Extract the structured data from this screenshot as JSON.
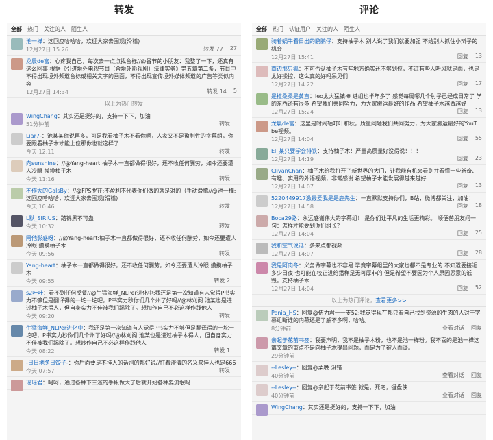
{
  "headers": {
    "left": "转发",
    "right": "评论"
  },
  "left": {
    "tabs": [
      "全部",
      "热门",
      "关注的人",
      "陌生人"
    ],
    "items": [
      {
        "user": "池一樺",
        "text": "：这回应哈哈哈，欢迎大家去围观(滑稽)",
        "time": "12月27日 15:26",
        "actions": [
          "转发 77",
          "27"
        ],
        "color": "#9bb"
      },
      {
        "user": "龙晨de富",
        "text": "：心疼我自己，每次去一点点找台标//@番节的小朋友：我整了一下，还真有这么回事 根据《引进境外电视节目（含境外影视剧）法律实务》第五章第二条，节目中不得出现境外频道台标或相关文字的画面，不得出现宣传境外媒体频道的广告等类似内容",
        "time": "12月27日 14:34",
        "actions": [
          "转发 14",
          "5"
        ],
        "color": "#c98"
      }
    ],
    "sep": "以上为热门转发",
    "items2": [
      {
        "user": "WingChang",
        "text": "：其实还是挺好的，支持一下下，加油",
        "time": "51分钟前",
        "actions": [
          "转发",
          ""
        ],
        "color": "#a9c"
      },
      {
        "user": "Liar7-",
        "text": "：池某某你说再多，可是我看柚子木不看你啊，人家又不是盈利性的字幕组，你要跟看柚子木才能上位那你也就这样了",
        "time": "今天 12:11",
        "actions": [
          "转发",
          ""
        ],
        "color": "#ccc"
      },
      {
        "user": "向sunshine",
        "text": "：//@Yang-heart:柚子木一直都做得很好，还不收任何酬劳，如今还要遭人冷眼 摸摸柚子木",
        "time": "今天 11:16",
        "actions": [
          "转发",
          ""
        ],
        "color": "#dcb"
      },
      {
        "user": "不作大的GalsBy",
        "text": "：//@FPS罗茌:不盈利不代表你们做的就是对的（手动滑稽//@池一樺:这回应哈哈哈，欢迎大家去围观(滑稽)",
        "time": "今天 10:46",
        "actions": [
          "转发",
          ""
        ],
        "color": "#bca"
      },
      {
        "user": "L默_SIRIUS",
        "text": "：踏锦黑不可蛊",
        "time": "今天 10:32",
        "actions": [
          "转发",
          ""
        ],
        "color": "#556"
      },
      {
        "user": "阿他影感呀",
        "text": "：//@Yang-heart:柚子木一直都做得很好，还不收任何酬劳，如今还要遭人冷眼 摸摸柚子木",
        "time": "今天 09:56",
        "actions": [
          "转发",
          ""
        ],
        "color": "#b97"
      },
      {
        "user": "Yang-heart",
        "text": "：柚子木一直都做得很好，还不收任何酬劳，如今还要遭人冷眼 摸摸柚子木",
        "time": "今天 09:55",
        "actions": [
          "转发 2",
          ""
        ],
        "color": "#ccc"
      },
      {
        "user": "s2叶叶",
        "text": "：看不到任何反餐//@生猛海鲜_NLPer进化中:我还是第一次知道有人觉得P书实力不够但是翻译得的一坨一坨吧，P书实力秒你们几个州了好吗//@林刈阁:池某也是进过柚子木得人，但自身实力不佳被我们踢除了。想加作自己不必这样作践他人",
        "time": "今天 09:20",
        "actions": [
          "转发",
          ""
        ],
        "color": "#9ac"
      },
      {
        "user": "生猛海鲜_NLPer进化中",
        "text": "：我还是第一次知道有人觉得P书实力不够但是翻译得的一坨一坨吧，P书实力秒你们几个州了好吗//@林刈阁:池某也是进过柚子木得人，但自身实力不佳被我们踢除了。想炒作自己不必这样作践他人",
        "time": "今天 08:22",
        "actions": [
          "转发 1",
          ""
        ],
        "color": "#68a"
      },
      {
        "user": "-日日地冬日饺子-",
        "text": "：你后面要是不挂人的话别的都好说//打着澄清的名义来挂人也是666",
        "time": "今天 07:57",
        "actions": [
          "转发",
          ""
        ],
        "color": "#ca8"
      },
      {
        "user": "瑶瑶君",
        "text": "：呵呵，通过各种下三滥的手段做大了后就开始各种耍流氓吗",
        "time": "",
        "actions": [
          "",
          ""
        ],
        "color": "#c99"
      }
    ]
  },
  "right": {
    "tabs": [
      "全部",
      "热门",
      "认证用户",
      "关注的人",
      "陌生人"
    ],
    "items": [
      {
        "user": "骑着蜗牛看日出的鹏鹏仔",
        "text": "：支持柚子木 别人说了我们就要加强 不给别人抓住小辫子的机会",
        "time": "12月27日 15:41",
        "actions": [
          "回复",
          "13"
        ],
        "color": "#9a7"
      },
      {
        "user": "南边那只狐",
        "text": "：不可否认柚子木有些地方确实还不够到位，不过有些人听风就是雨，也是太好操控，这么真的好吗呆见们",
        "time": "12月27日 14:22",
        "actions": [
          "回复",
          "17"
        ],
        "color": "#dbb"
      },
      {
        "user": "是植桑桑是黄直",
        "text": "：leo太大猛镇棒 进组也半年多了 感觉每周哪几个肘子已经成日常了 学的东西还有很多 希望我们共同努力，为大家搬运最好的作品 希望柚子木越做越好",
        "time": "12月27日 15:24",
        "actions": [
          "回复",
          "13"
        ],
        "color": "#9b8"
      },
      {
        "user": "龙晨de富",
        "text": "：这里是时间轴叮叶和秋，质量问题我们共同努力，为大家搬运最好的YouTube视频。",
        "time": "12月27日 14:04",
        "actions": [
          "回复",
          "55"
        ],
        "color": "#c98"
      },
      {
        "user": "El_某只要学会排铁",
        "text": "：支持柚子木！严量高质量好没得说！！！",
        "time": "12月27日 14:19",
        "actions": [
          "回复",
          "23"
        ],
        "color": "#8a9"
      },
      {
        "user": "ClivanChan",
        "text": "：柚子木给我打开了新世界的大门，让我能有机会看到并看懂一些新奇、有趣、实用的外语视频，非常感谢 希望柚子木能发展得越来越好",
        "time": "12月27日 14:07",
        "actions": [
          "回复",
          "13"
        ],
        "color": "#9a8"
      },
      {
        "user": "5220449917激最爱我是是鹿先生",
        "text": "：一直默默支持你们，B站，微博都关注，加油！",
        "time": "12月27日 14:58",
        "actions": [
          "回复",
          "18"
        ],
        "color": "#ccc"
      },
      {
        "user": "Boca29路",
        "text": "：永远感谢伟大的字幕组！ 是你们让平凡的生活更精彩。 顺便替朋友问一句：怎样才能要到你们组长？",
        "time": "12月27日 14:04",
        "actions": [
          "回复",
          "25"
        ],
        "color": "#caa"
      },
      {
        "user": "我和空气说话",
        "text": "：多来点都视频",
        "time": "12月27日 14:07",
        "actions": [
          "回复",
          "28"
        ],
        "color": "#bbb"
      },
      {
        "user": "我是阿肉冬",
        "text": "：义务做字幕也不容易 毕竟字幕组里的大家也都不是专业的 不知道要接近多少日夜 也可能在校正进给播样是无可厚非的 但是希望不要因为个人原因恶意的诋毁。支持柚子木",
        "time": "12月27日 14:04",
        "actions": [
          "回复",
          "52"
        ],
        "color": "#c8a"
      }
    ],
    "sep": "以上为热门评论，",
    "sepmore": "查看更多>>",
    "items2": [
      {
        "user": "Ponia_HS",
        "text": "：回复@伍力君一一支52:我觉得现在都只看自己找到资源的生肉的人对于字幕组断谁的内幕还是了解不多啊，哈哈。",
        "time": "8分钟前",
        "actions": [
          "查看对话",
          "回复"
        ],
        "color": "#bcb"
      },
      {
        "user": "亲起于花前书签",
        "text": "：我要声明，我不是柚子木粉，也不是池一樺粉。我不喜的是池一樺这篇文章的重点不是向柚子木提出问题，而是为了被人而谈。",
        "time": "29分钟前",
        "actions": [
          "",
          ""
        ],
        "color": "#c9a"
      },
      {
        "user": "--Lesley--",
        "text": "：回复@栗晚:没错",
        "time": "40分钟前",
        "actions": [
          "查看对话",
          "回复"
        ],
        "color": "#dcc"
      },
      {
        "user": "--Lesley--",
        "text": "：回复@亲起于花前书签:就是，死宅，键盘侠",
        "time": "40分钟前",
        "actions": [
          "查看对话",
          "回复"
        ],
        "color": "#dcc"
      },
      {
        "user": "WingChang",
        "text": "：其实还是挺好的，支持一下下，加油",
        "time": "",
        "actions": [
          "",
          ""
        ],
        "color": "#a9c"
      }
    ]
  }
}
